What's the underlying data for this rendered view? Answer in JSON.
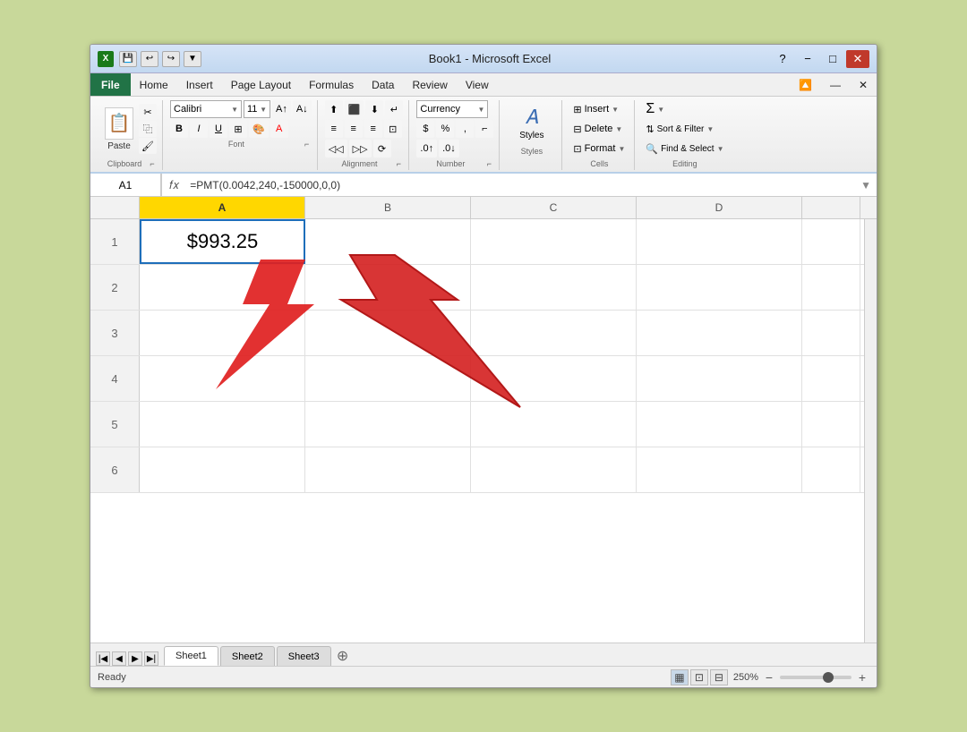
{
  "window": {
    "title": "Book1 - Microsoft Excel",
    "icon": "X"
  },
  "title_bar": {
    "title": "Book1 - Microsoft Excel",
    "minimize": "−",
    "maximize": "□",
    "close": "✕",
    "quick_access": [
      "💾",
      "↩",
      "↪"
    ]
  },
  "menu": {
    "file": "File",
    "items": [
      "Home",
      "Insert",
      "Page Layout",
      "Formulas",
      "Data",
      "Review",
      "View"
    ]
  },
  "ribbon": {
    "clipboard": {
      "label": "Clipboard",
      "paste_label": "Paste"
    },
    "font": {
      "label": "Font",
      "name": "Calibri",
      "size": "11",
      "bold": "B",
      "italic": "I",
      "underline": "U"
    },
    "alignment": {
      "label": "Alignment"
    },
    "number": {
      "label": "Number",
      "format": "Currency"
    },
    "styles": {
      "label": "Styles",
      "btn": "Styles"
    },
    "cells": {
      "label": "Cells",
      "insert": "Insert",
      "delete": "Delete",
      "format": "Format"
    },
    "editing": {
      "label": "Editing"
    }
  },
  "formula_bar": {
    "name_box": "A1",
    "formula": "=PMT(0.0042,240,-150000,0,0)"
  },
  "columns": [
    "A",
    "B",
    "C",
    "D"
  ],
  "rows": [
    {
      "num": "1",
      "a_value": "$993.25",
      "selected": true
    },
    {
      "num": "2",
      "a_value": ""
    },
    {
      "num": "3",
      "a_value": ""
    },
    {
      "num": "4",
      "a_value": ""
    },
    {
      "num": "5",
      "a_value": ""
    },
    {
      "num": "6",
      "a_value": ""
    }
  ],
  "sheet_tabs": [
    "Sheet1",
    "Sheet2",
    "Sheet3"
  ],
  "active_sheet": "Sheet1",
  "status": {
    "ready": "Ready",
    "zoom": "250%"
  }
}
